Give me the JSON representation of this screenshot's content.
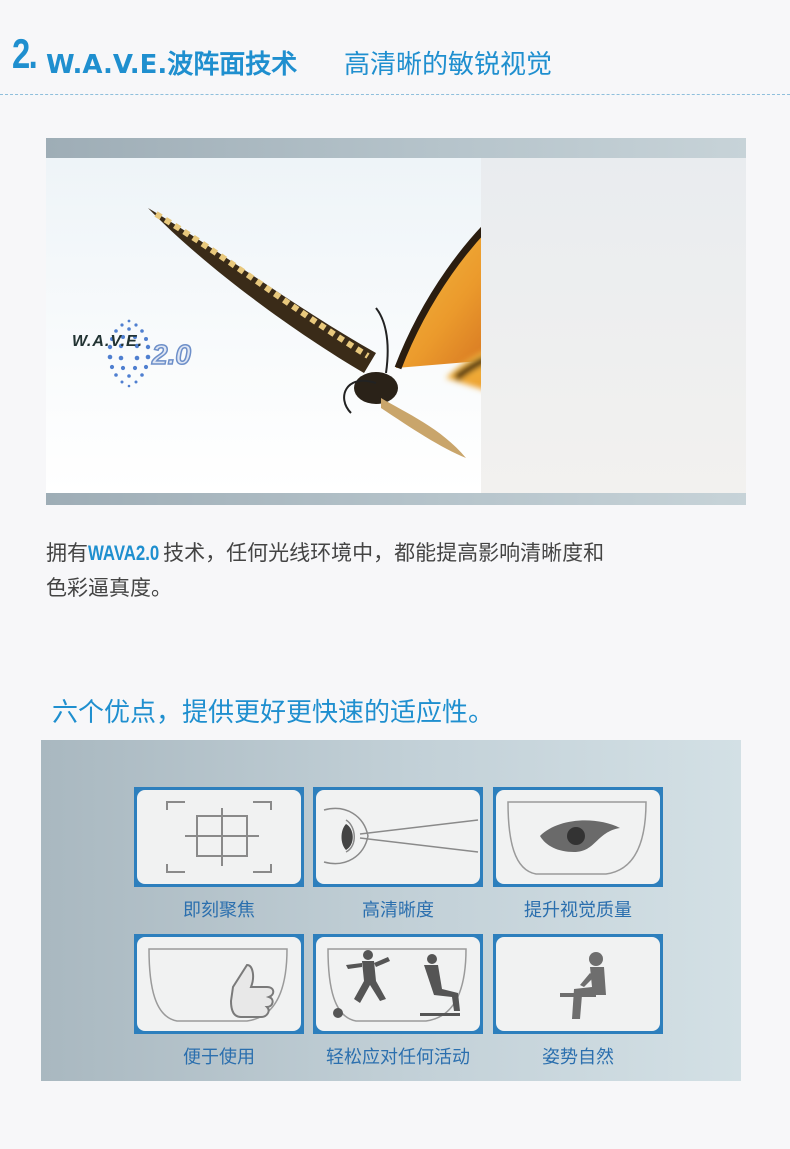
{
  "header": {
    "number": "2.",
    "title": "W.A.V.E.波阵面技术",
    "subtitle": "高清晰的敏锐视觉"
  },
  "hero": {
    "logo_wordmark": "W.A.V.E.",
    "logo_version": "2.0"
  },
  "description": {
    "prefix": "拥有",
    "highlight": "WAVA2.0",
    "line1_rest": "技术，任何光线环境中，都能提高影响清晰度和",
    "line2": "色彩逼真度。"
  },
  "advantages": {
    "title": "六个优点，提供更好更快速的适应性。",
    "items": [
      {
        "label": "即刻聚焦",
        "icon": "focus-frame-icon"
      },
      {
        "label": "高清晰度",
        "icon": "eye-side-view-icon"
      },
      {
        "label": "提升视觉质量",
        "icon": "eye-icon"
      },
      {
        "label": "便于使用",
        "icon": "thumbs-up-icon"
      },
      {
        "label": "轻松应对任何活动",
        "icon": "activity-figures-icon"
      },
      {
        "label": "姿势自然",
        "icon": "seated-person-icon"
      }
    ]
  },
  "colors": {
    "accent": "#1f8fcf",
    "card_border": "#2d7fbd",
    "label": "#2b6fae"
  }
}
